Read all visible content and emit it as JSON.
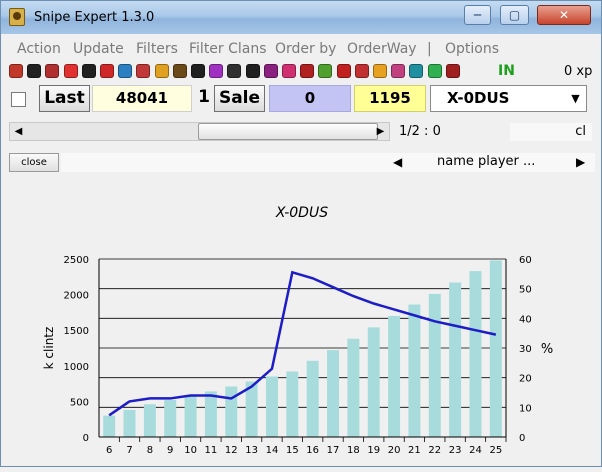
{
  "window": {
    "title": "Snipe Expert 1.3.0",
    "min_glyph": "─",
    "max_glyph": "▢",
    "close_glyph": "✕"
  },
  "menu": [
    {
      "label": "Action"
    },
    {
      "label": "Update"
    },
    {
      "label": "Filters"
    },
    {
      "label": "Filter Clans"
    },
    {
      "label": "Order by"
    },
    {
      "label": "OrderWay"
    },
    {
      "label": "|"
    },
    {
      "label": "Options"
    }
  ],
  "iconbar": {
    "icons": [
      {
        "name": "clan-icon-1",
        "color": "#c0392b"
      },
      {
        "name": "clan-icon-2",
        "color": "#222222"
      },
      {
        "name": "clan-icon-3",
        "color": "#b03030"
      },
      {
        "name": "clan-icon-4",
        "color": "#e03030"
      },
      {
        "name": "clan-icon-5",
        "color": "#202020"
      },
      {
        "name": "clan-icon-6",
        "color": "#d02828"
      },
      {
        "name": "clan-icon-7",
        "color": "#2a80c0"
      },
      {
        "name": "clan-icon-8",
        "color": "#c03838"
      },
      {
        "name": "clan-icon-9",
        "color": "#e0a020"
      },
      {
        "name": "clan-icon-10",
        "color": "#6a4a18"
      },
      {
        "name": "clan-icon-11",
        "color": "#202020"
      },
      {
        "name": "clan-icon-12",
        "color": "#a030c0"
      },
      {
        "name": "clan-icon-13",
        "color": "#303030"
      },
      {
        "name": "clan-icon-14",
        "color": "#202020"
      },
      {
        "name": "clan-icon-15",
        "color": "#8a2080"
      },
      {
        "name": "clan-icon-16",
        "color": "#d03070"
      },
      {
        "name": "clan-icon-17",
        "color": "#b02020"
      },
      {
        "name": "clan-icon-18",
        "color": "#50a030"
      },
      {
        "name": "clan-icon-19",
        "color": "#c02020"
      },
      {
        "name": "clan-icon-20",
        "color": "#c03030"
      },
      {
        "name": "clan-icon-21",
        "color": "#e8a020"
      },
      {
        "name": "clan-icon-22",
        "color": "#c04080"
      },
      {
        "name": "clan-icon-23",
        "color": "#2090a0"
      },
      {
        "name": "clan-icon-24",
        "color": "#30b050"
      },
      {
        "name": "clan-icon-25",
        "color": "#a02020"
      }
    ],
    "status": "IN",
    "xp": "0 xp"
  },
  "controls": {
    "last_label": "Last",
    "total_value": "48041",
    "count_value": "1",
    "sale_label": "Sale",
    "zero_value": "0",
    "price_value": "1195",
    "player_select": "X-0DUS"
  },
  "paging": {
    "indicator": "1/2 : 0",
    "cl_label": "cl",
    "close_label": "close",
    "sort_label": "name player ..."
  },
  "chart_data": {
    "type": "bar",
    "title": "X-0DUS",
    "ylabel_left": "k clintz",
    "ylabel_right": "%",
    "categories": [
      "6",
      "7",
      "8",
      "9",
      "10",
      "11",
      "12",
      "13",
      "14",
      "15",
      "16",
      "17",
      "18",
      "19",
      "20",
      "21",
      "22",
      "23",
      "24",
      "25"
    ],
    "y_left": {
      "min": 0,
      "max": 2500,
      "ticks": [
        0,
        500,
        1000,
        1500,
        2000,
        2500
      ]
    },
    "y_right": {
      "min": 0,
      "max": 60,
      "ticks": [
        0,
        10,
        20,
        30,
        40,
        50,
        60
      ]
    },
    "series": [
      {
        "kind": "bar",
        "axis": "left",
        "color": "#a8dcdc",
        "values": [
          300,
          380,
          460,
          520,
          580,
          640,
          710,
          780,
          850,
          920,
          1070,
          1220,
          1380,
          1540,
          1700,
          1860,
          2010,
          2170,
          2330,
          2480
        ]
      },
      {
        "kind": "line",
        "axis": "right",
        "color": "#1c1cc8",
        "values": [
          7.3,
          12,
          13,
          13,
          14,
          14,
          13,
          17,
          23,
          55.5,
          53.5,
          50.5,
          47.5,
          45,
          43,
          41,
          39,
          37.5,
          36,
          34.5
        ]
      }
    ],
    "grid": true
  }
}
